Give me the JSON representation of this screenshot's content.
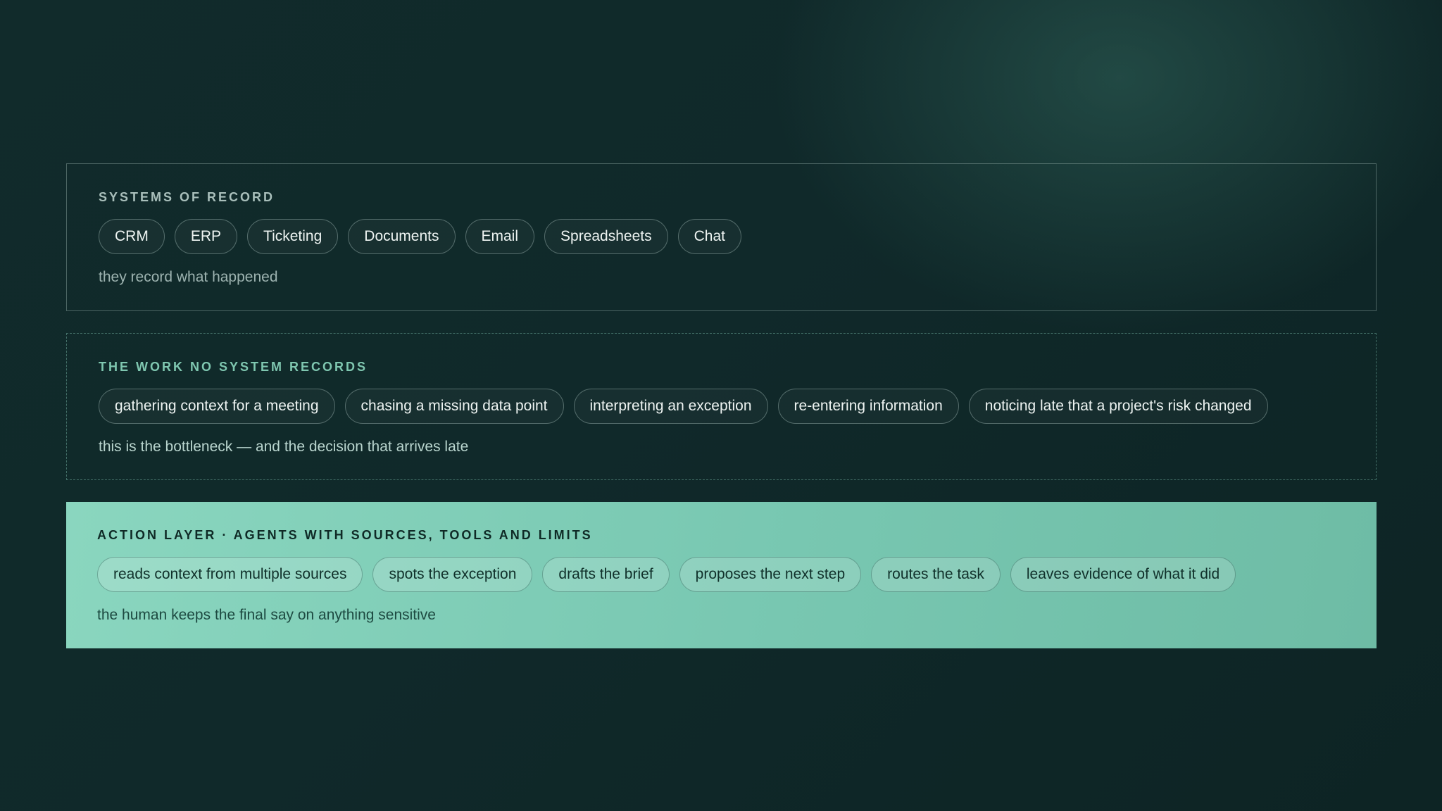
{
  "layers": [
    {
      "heading": "SYSTEMS OF RECORD",
      "chips": [
        "CRM",
        "ERP",
        "Ticketing",
        "Documents",
        "Email",
        "Spreadsheets",
        "Chat"
      ],
      "note": "they record what happened"
    },
    {
      "heading": "THE WORK NO SYSTEM RECORDS",
      "chips": [
        "gathering context for a meeting",
        "chasing a missing data point",
        "interpreting an exception",
        "re-entering information",
        "noticing late that a project's risk changed"
      ],
      "note": "this is the bottleneck — and the decision that arrives late"
    },
    {
      "heading": "ACTION LAYER · AGENTS WITH SOURCES, TOOLS AND LIMITS",
      "chips": [
        "reads context from multiple sources",
        "spots the exception",
        "drafts the brief",
        "proposes the next step",
        "routes the task",
        "leaves evidence of what it did"
      ],
      "note": "the human keeps the final say on anything sensitive"
    }
  ],
  "colors": {
    "background": "#112b2b",
    "action_layer": "#7fcdb6",
    "accent_heading": "#7fc7b0"
  }
}
